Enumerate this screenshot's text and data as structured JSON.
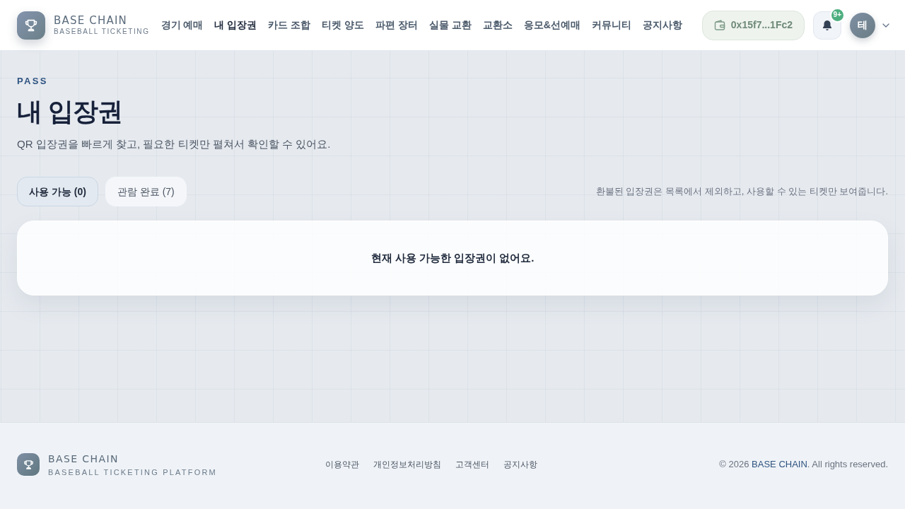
{
  "header": {
    "logo": {
      "title": "BASE CHAIN",
      "subtitle": "BASEBALL TICKETING"
    },
    "nav": [
      {
        "label": "경기 예매",
        "selected": false
      },
      {
        "label": "내 입장권",
        "selected": true
      },
      {
        "label": "카드 조합",
        "selected": false
      },
      {
        "label": "티켓 양도",
        "selected": false
      },
      {
        "label": "파편 장터",
        "selected": false
      },
      {
        "label": "실물 교환",
        "selected": false
      },
      {
        "label": "교환소",
        "selected": false
      },
      {
        "label": "응모&선예매",
        "selected": false
      },
      {
        "label": "커뮤니티",
        "selected": false
      },
      {
        "label": "공지사항",
        "selected": false
      }
    ],
    "wallet": {
      "address": "0x15f7...1Fc2"
    },
    "notifications": {
      "badge": "9+"
    },
    "avatar": {
      "initial": "테"
    }
  },
  "page": {
    "eyebrow": "PASS",
    "title": "내 입장권",
    "description": "QR 입장권을 빠르게 찾고, 필요한 티켓만 펼쳐서 확인할 수 있어요.",
    "tabs": [
      {
        "label": "사용 가능 (0)",
        "selected": true
      },
      {
        "label": "관람 완료 (7)",
        "selected": false
      }
    ],
    "note": "환불된 입장권은 목록에서 제외하고, 사용할 수 있는 티켓만 보여줍니다.",
    "empty_message": "현재 사용 가능한 입장권이 없어요."
  },
  "footer": {
    "logo": {
      "title": "BASE CHAIN",
      "subtitle": "BASEBALL TICKETING PLATFORM"
    },
    "links": [
      "이용약관",
      "개인정보처리방침",
      "고객센터",
      "공지사항"
    ],
    "copyright": {
      "prefix": "© 2026 ",
      "brand": "BASE CHAIN",
      "suffix": ". All rights reserved."
    }
  }
}
